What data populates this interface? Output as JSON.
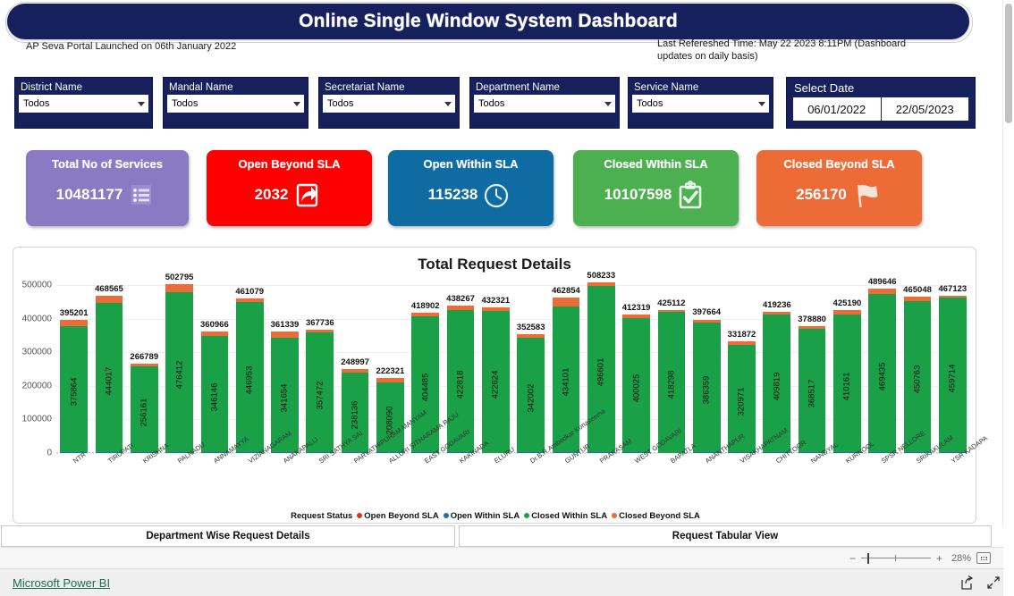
{
  "header": {
    "title": "Online Single Window System Dashboard",
    "launch_caption": "AP Seva Portal Launched on 06th January 2022",
    "refresh_caption": "Last Refereshed Time: May 22 2023 8:11PM (Dashboard updates on daily basis)"
  },
  "slicers": [
    {
      "label": "District Name",
      "value": "Todos"
    },
    {
      "label": "Mandal Name",
      "value": "Todos"
    },
    {
      "label": "Secretariat Name",
      "value": "Todos"
    },
    {
      "label": "Department Name",
      "value": "Todos"
    },
    {
      "label": "Service Name",
      "value": "Todos"
    }
  ],
  "date_slicer": {
    "label": "Select Date",
    "start": "06/01/2022",
    "end": "22/05/2023"
  },
  "kpis": [
    {
      "title": "Total No of Services",
      "value": "10481177",
      "color": "#8a7ac4",
      "icon": "list-icon"
    },
    {
      "title": "Open Beyond SLA",
      "value": "2032",
      "color": "#fe0000",
      "icon": "share-arrow-icon"
    },
    {
      "title": "Open Within SLA",
      "value": "115238",
      "color": "#0e6ca3",
      "icon": "clock-icon"
    },
    {
      "title": "Closed WIthin SLA",
      "value": "10107598",
      "color": "#4cb050",
      "icon": "clipboard-check-icon"
    },
    {
      "title": "Closed Beyond SLA",
      "value": "256170",
      "color": "#ec6b36",
      "icon": "flag-icon"
    }
  ],
  "chart_data": {
    "type": "bar",
    "title": "Total Request Details",
    "subtitle": "",
    "xlabel": "",
    "ylabel": "",
    "ylim": [
      0,
      500000
    ],
    "yticks": [
      0,
      100000,
      200000,
      300000,
      400000,
      500000
    ],
    "grid": true,
    "stacked": true,
    "legend_position": "bottom",
    "legend_title": "Request Status",
    "legend": [
      {
        "name": "Open Beyond SLA",
        "color": "#e03020"
      },
      {
        "name": "Open Within SLA",
        "color": "#1f6fb5"
      },
      {
        "name": "Closed Within SLA",
        "color": "#1aa147"
      },
      {
        "name": "Closed Beyond SLA",
        "color": "#ec6b36"
      }
    ],
    "categories": [
      "NTR",
      "TIRUPATI",
      "KRISHNA",
      "PALNADU",
      "ANNAMAYYA",
      "VIZIANAGARAM",
      "ANAKAPALLI",
      "SRI SATHYA SAI",
      "PARVATHIPURAM MANYAM",
      "ALLURI SITHARAMA RAJU",
      "EAST GODAVARI",
      "KAKINADA",
      "ELURU",
      "Dr.B.R.Ambedkar Konaseema",
      "GUNTUR",
      "PRAKASAM",
      "WEST GODAVARI",
      "BAPATLA",
      "ANANTHAPUR",
      "VISAKHAPATNAM",
      "CHITTOOR",
      "NANDYAL",
      "KURNOOL",
      "SPSR NELLORE",
      "SRIKAKULAM",
      "YSR KADAPA"
    ],
    "totals": [
      395201,
      468565,
      266789,
      502795,
      360966,
      461079,
      361339,
      367736,
      248997,
      222321,
      418902,
      438267,
      432321,
      352583,
      462854,
      508233,
      412319,
      425112,
      397664,
      331872,
      419236,
      378880,
      425190,
      489646,
      465048,
      467123
    ],
    "series": [
      {
        "name": "Closed Within SLA",
        "color": "#1aa147",
        "values": [
          375864,
          444017,
          256161,
          476412,
          346146,
          446953,
          341654,
          357472,
          238136,
          208090,
          404485,
          422818,
          422624,
          342002,
          434101,
          496601,
          400025,
          418298,
          386359,
          320971,
          409819,
          368517,
          410161,
          469435,
          450763,
          459714
        ]
      },
      {
        "name": "Closed Beyond SLA",
        "color": "#ec6b36",
        "values": [
          17537,
          22748,
          9128,
          24383,
          13020,
          12126,
          17085,
          8264,
          9361,
          12731,
          12417,
          13449,
          8697,
          9081,
          26753,
          9632,
          10294,
          5814,
          9305,
          9301,
          7417,
          8363,
          12029,
          17211,
          12285,
          5409
        ]
      },
      {
        "name": "Open Within SLA",
        "color": "#1f6fb5",
        "values": [
          1700,
          1700,
          1400,
          1900,
          1700,
          1900,
          2500,
          1900,
          1400,
          1400,
          1900,
          1900,
          900,
          1400,
          1900,
          1900,
          1900,
          900,
          1900,
          1500,
          1900,
          1900,
          2900,
          2900,
          1900,
          1900
        ]
      },
      {
        "name": "Open Beyond SLA",
        "color": "#e03020",
        "values": [
          100,
          100,
          100,
          100,
          100,
          100,
          100,
          100,
          100,
          100,
          100,
          100,
          100,
          100,
          100,
          100,
          100,
          100,
          100,
          100,
          100,
          100,
          100,
          100,
          100,
          100
        ]
      }
    ]
  },
  "tabs": [
    {
      "label": "Department Wise Request Details"
    },
    {
      "label": "Request Tabular View"
    }
  ],
  "zoom": {
    "minus": "−",
    "plus": "+",
    "percent": "28%",
    "fit_icon": "fit-to-page-icon"
  },
  "footer": {
    "brand": "Microsoft Power BI",
    "share_icon": "share-icon",
    "fullscreen_icon": "fullscreen-icon"
  }
}
